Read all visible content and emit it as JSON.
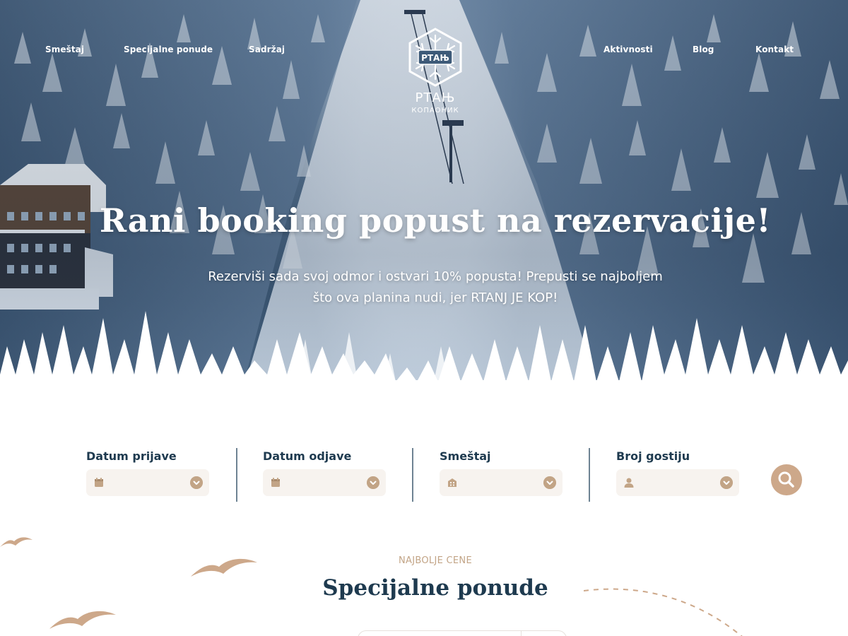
{
  "nav": {
    "left": [
      "Smeštaj",
      "Specijalne ponude",
      "Sadržaj"
    ],
    "right": [
      "Aktivnosti",
      "Blog",
      "Kontakt"
    ]
  },
  "logo": {
    "monogram": "РТАЊ",
    "name": "РТАЊ",
    "subtitle": "КОПАОНИК"
  },
  "hero": {
    "title": "Rani booking popust na rezervacije!",
    "subtitle_line1": "Rezerviši sada svoj odmor i ostvari 10% popusta! Prepusti se najboljem",
    "subtitle_line2": "što ova planina nudi, jer RTANJ JE KOP!"
  },
  "search": {
    "fields": [
      {
        "label": "Datum prijave",
        "icon": "calendar-icon",
        "value": ""
      },
      {
        "label": "Datum odjave",
        "icon": "calendar-icon",
        "value": ""
      },
      {
        "label": "Smeštaj",
        "icon": "hotel-icon",
        "value": ""
      },
      {
        "label": "Broj gostiju",
        "icon": "user-icon",
        "value": ""
      }
    ],
    "button_icon": "search-icon"
  },
  "section": {
    "eyebrow": "NAJBOLJE CENE",
    "title": "Specijalne ponude"
  },
  "colors": {
    "navy": "#1e3a4f",
    "tan": "#c2a486",
    "tan_button": "#cda88a",
    "field_bg": "#f7f3ef",
    "divider": "#6e8393"
  }
}
